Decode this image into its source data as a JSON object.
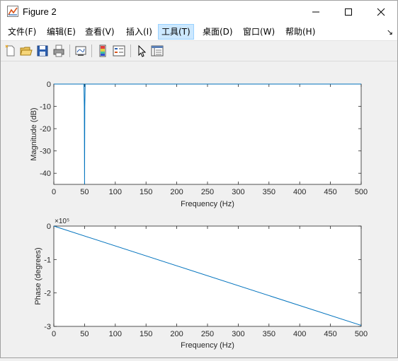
{
  "window": {
    "title": "Figure 2"
  },
  "menu": {
    "items": [
      {
        "label": "文件(F)"
      },
      {
        "label": "编辑(E)"
      },
      {
        "label": "查看(V)"
      },
      {
        "label": "插入(I)"
      },
      {
        "label": "工具(T)"
      },
      {
        "label": "桌面(D)"
      },
      {
        "label": "窗口(W)"
      },
      {
        "label": "帮助(H)"
      }
    ],
    "active_index": 4
  },
  "toolbar": {
    "buttons": [
      "new-figure-icon",
      "open-file-icon",
      "save-icon",
      "print-icon",
      "link-plot-icon",
      "insert-colorbar-icon",
      "insert-legend-icon",
      "edit-plot-arrow-icon",
      "property-inspector-icon"
    ]
  },
  "colors": {
    "line": "#0072bd",
    "axes_bg": "#ffffff",
    "figure_bg": "#f0f0f0"
  },
  "chart_data": [
    {
      "type": "line",
      "xlabel": "Frequency (Hz)",
      "ylabel": "Magnitude (dB)",
      "xlim": [
        0,
        500
      ],
      "ylim": [
        -45,
        0
      ],
      "xticks": [
        "0",
        "50",
        "100",
        "150",
        "200",
        "250",
        "300",
        "350",
        "400",
        "450",
        "500"
      ],
      "yticks": [
        "0",
        "-10",
        "-20",
        "-30",
        "-40"
      ],
      "x": [
        0,
        49,
        49.6,
        50,
        50.4,
        51,
        500
      ],
      "y": [
        0,
        0,
        -10,
        -45,
        -10,
        0,
        0
      ],
      "grid": false
    },
    {
      "type": "line",
      "xlabel": "Frequency (Hz)",
      "ylabel": "Phase (degrees)",
      "xlim": [
        0,
        500
      ],
      "ylim": [
        -3,
        0
      ],
      "exponent_label": "×10⁵",
      "xticks": [
        "0",
        "50",
        "100",
        "150",
        "200",
        "250",
        "300",
        "350",
        "400",
        "450",
        "500"
      ],
      "yticks": [
        "0",
        "-1",
        "-2",
        "-3"
      ],
      "x": [
        0,
        500
      ],
      "y": [
        0,
        -2.97
      ],
      "grid": false
    }
  ]
}
